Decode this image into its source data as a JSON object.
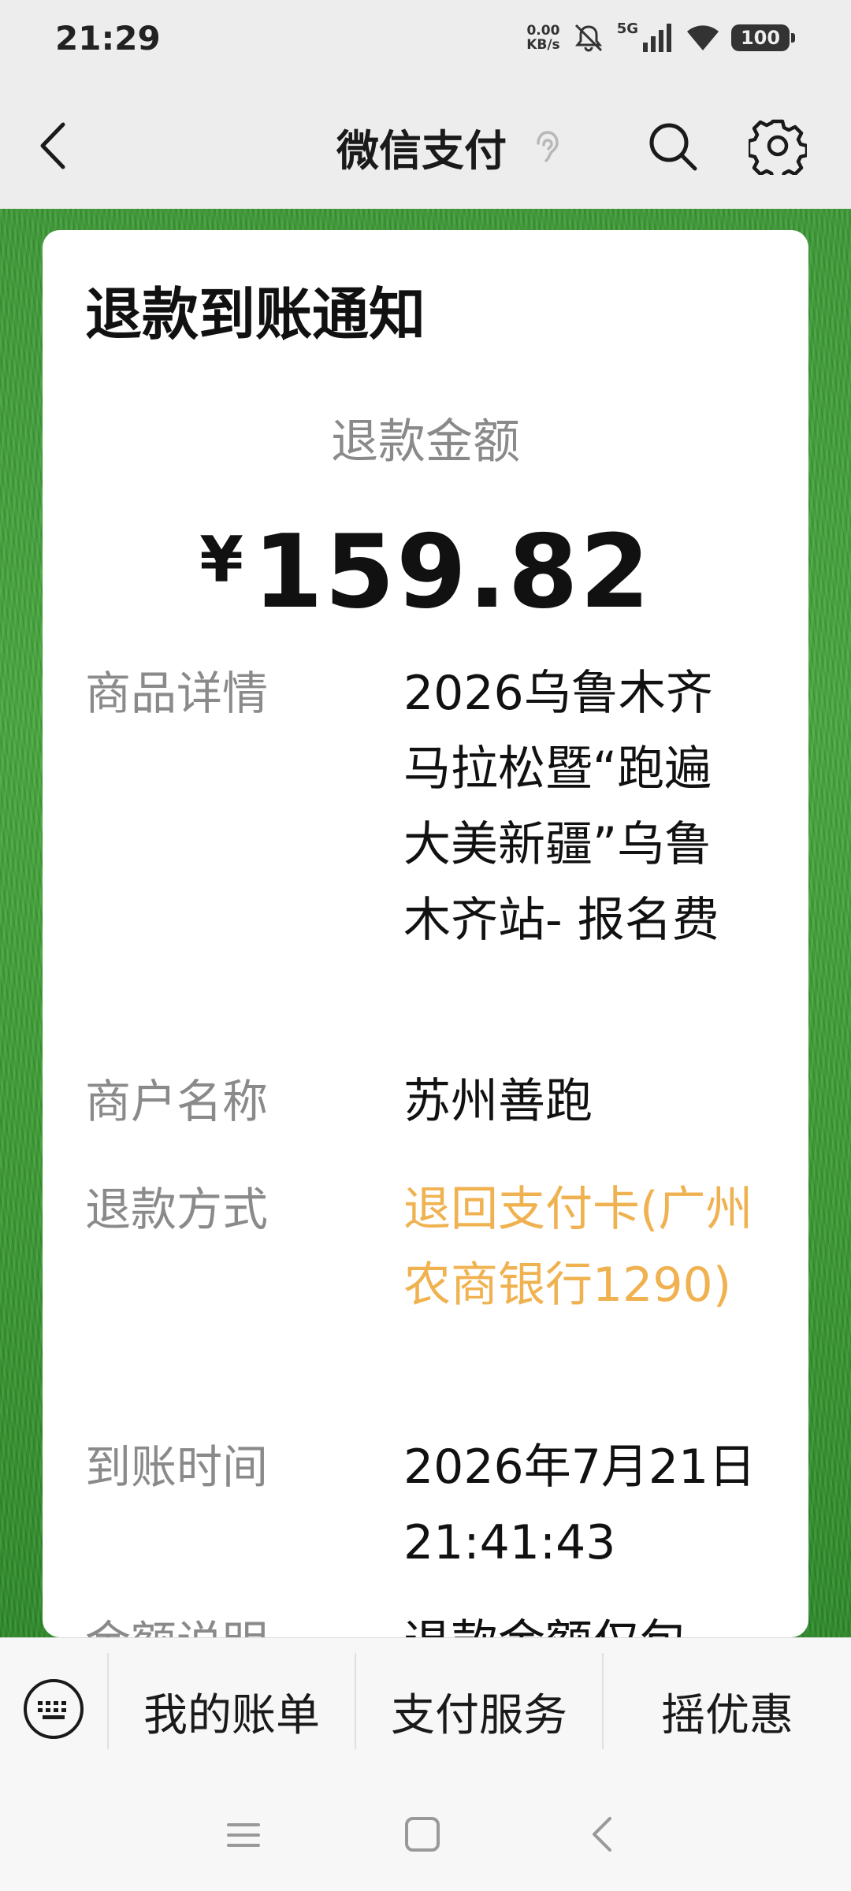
{
  "status_bar": {
    "time": "21:29",
    "net_speed_value": "0.00",
    "net_speed_unit": "KB/s",
    "network_type": "5G",
    "battery": "100",
    "icons": [
      "mute-icon",
      "signal-icon",
      "wifi-icon",
      "battery-icon"
    ]
  },
  "nav": {
    "title": "微信支付",
    "icons": [
      "back-icon",
      "ear-icon",
      "search-icon",
      "settings-icon"
    ]
  },
  "card": {
    "title": "退款到账通知",
    "amount_label": "退款金额",
    "currency": "¥",
    "amount": "159.82",
    "rows": [
      {
        "label": "商品详情",
        "value": "2026乌鲁木齐马拉松暨“跑遍大美新疆”乌鲁木齐站- 报名费"
      },
      {
        "label": "商户名称",
        "value": "苏州善跑"
      },
      {
        "label": "退款方式",
        "value": "退回支付卡(广州农商银行1290)"
      },
      {
        "label": "到账时间",
        "value": "2026年7月21日 21:41:43"
      },
      {
        "label": "金额说明",
        "value": "退款金额仅包"
      }
    ],
    "accent_color": "#f0b250"
  },
  "menu": {
    "items": [
      "我的账单",
      "支付服务",
      "摇优惠"
    ],
    "icons": [
      "keyboard-icon"
    ]
  },
  "system_nav": {
    "icons": [
      "recents-icon",
      "home-icon",
      "back-icon"
    ]
  }
}
